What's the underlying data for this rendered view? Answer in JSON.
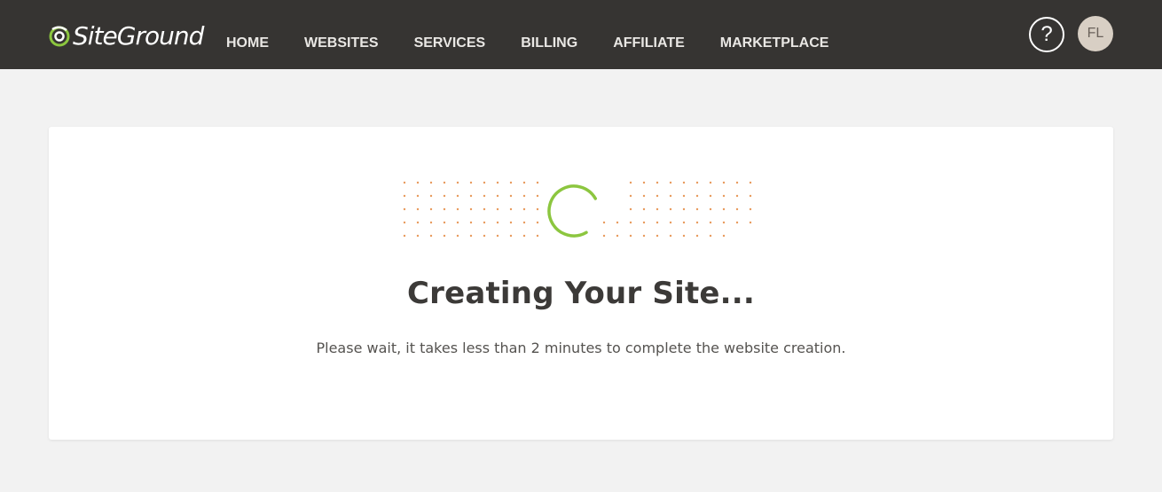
{
  "header": {
    "logo_text": "SiteGround",
    "nav": [
      "HOME",
      "WEBSITES",
      "SERVICES",
      "BILLING",
      "AFFILIATE",
      "MARKETPLACE"
    ],
    "help_label": "?",
    "avatar_initials": "FL"
  },
  "main": {
    "title": "Creating Your Site...",
    "subtitle": "Please wait, it takes less than 2 minutes to complete the website creation."
  },
  "colors": {
    "topbar": "#363432",
    "accent_green": "#8cc63f",
    "dots_orange": "#e89a5c",
    "background": "#f2f2f2"
  },
  "icons": {
    "logo": "siteground-logo-icon",
    "loader": "spinner-icon",
    "help": "question-mark-icon"
  }
}
